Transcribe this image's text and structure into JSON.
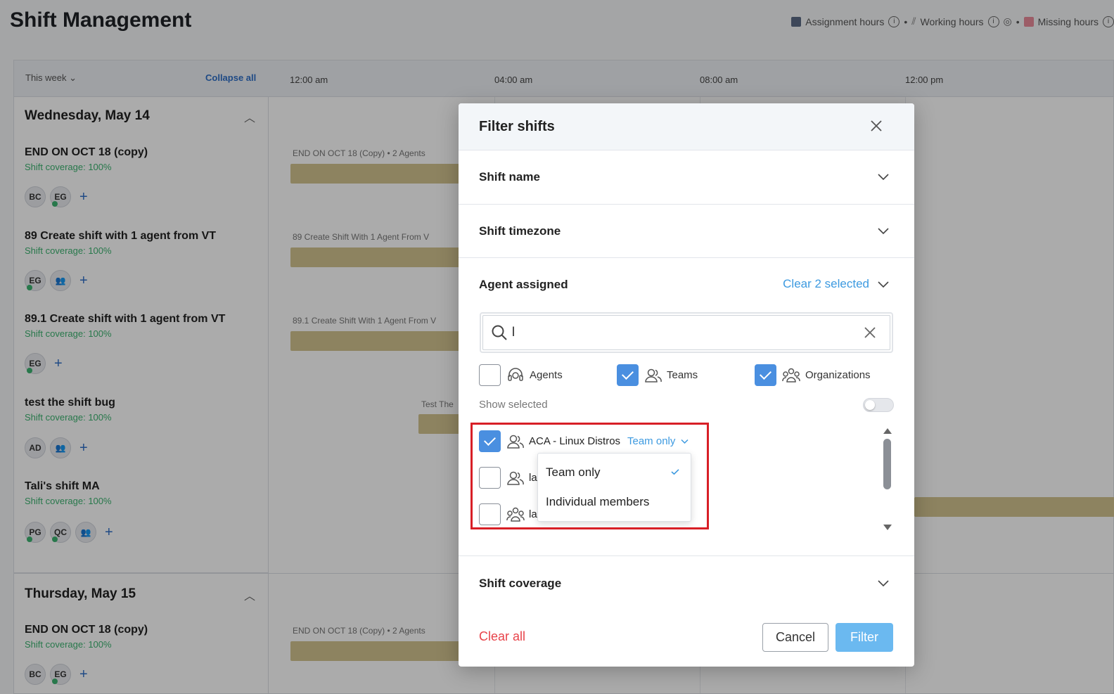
{
  "page": {
    "title": "Shift Management"
  },
  "legend": {
    "assignment": "Assignment hours",
    "working": "Working hours",
    "missing": "Missing hours",
    "assignment_color": "#5b6b85",
    "missing_color": "#e98b9a"
  },
  "schedule": {
    "week_select": "This week",
    "collapse_all": "Collapse all",
    "times": [
      "12:00 am",
      "04:00 am",
      "08:00 am",
      "12:00 pm"
    ],
    "days": [
      {
        "label": "Wednesday, May 14",
        "shifts": [
          {
            "name": "END ON OCT 18 (copy)",
            "coverage": "Shift coverage: 100%",
            "avatars": [
              "BC",
              "EG"
            ],
            "bar_label": "END ON OCT 18 (Copy) • 2 Agents"
          },
          {
            "name": "89 Create shift with 1 agent from VT",
            "coverage": "Shift coverage: 100%",
            "avatars": [
              "EG"
            ],
            "bar_label": "89 Create Shift With 1 Agent From V"
          },
          {
            "name": "89.1 Create shift with 1 agent from VT",
            "coverage": "Shift coverage: 100%",
            "avatars": [
              "EG"
            ],
            "bar_label": "89.1 Create Shift With 1 Agent From V"
          },
          {
            "name": "test the shift bug",
            "coverage": "Shift coverage: 100%",
            "avatars": [
              "AD"
            ],
            "bar_label": "Test The"
          },
          {
            "name": "Tali's shift MA",
            "coverage": "Shift coverage: 100%",
            "avatars": [
              "PG",
              "QC"
            ],
            "bar_label": ""
          }
        ]
      },
      {
        "label": "Thursday, May 15",
        "shifts": [
          {
            "name": "END ON OCT 18 (copy)",
            "coverage": "Shift coverage: 100%",
            "avatars": [
              "BC",
              "EG"
            ],
            "bar_label": "END ON OCT 18 (Copy) • 2 Agents"
          }
        ]
      }
    ]
  },
  "modal": {
    "title": "Filter shifts",
    "sections": {
      "shift_name": "Shift name",
      "shift_timezone": "Shift timezone",
      "agent_assigned": "Agent assigned",
      "clear_selected": "Clear 2 selected",
      "shift_coverage": "Shift coverage"
    },
    "search": {
      "value": "l",
      "placeholder": ""
    },
    "types": {
      "agents": {
        "label": "Agents",
        "checked": false
      },
      "teams": {
        "label": "Teams",
        "checked": true
      },
      "organizations": {
        "label": "Organizations",
        "checked": true
      }
    },
    "show_selected": "Show selected",
    "list": [
      {
        "label": "ACA - Linux Distros",
        "checked": true,
        "mode": "Team only",
        "icon": "team-icon"
      },
      {
        "label": "la",
        "checked": false,
        "icon": "team-icon"
      },
      {
        "label": "la",
        "checked": false,
        "icon": "organization-icon"
      }
    ],
    "dropdown": {
      "options": [
        "Team only",
        "Individual members"
      ],
      "selected": "Team only"
    },
    "footer": {
      "clear_all": "Clear all",
      "cancel": "Cancel",
      "filter": "Filter"
    }
  }
}
